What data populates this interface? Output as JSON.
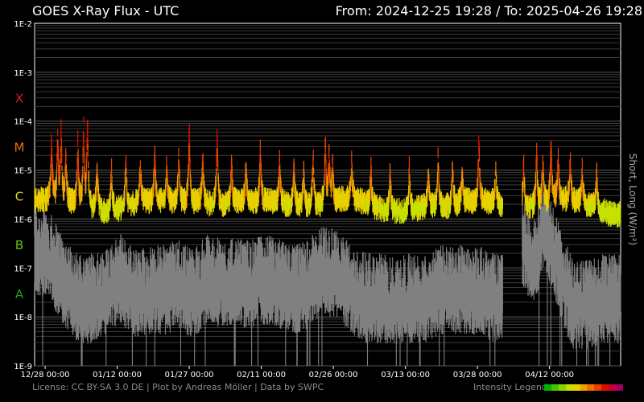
{
  "header": {
    "title": "GOES X-Ray Flux - UTC",
    "range": "From: 2024-12-25 19:28  /  To: 2025-04-26 19:28"
  },
  "footer": {
    "license": "License: CC BY-SA 3.0 DE | Plot by Andreas Möller | Data by SWPC",
    "legend_label": "Intensity Legend",
    "legend_colors": [
      "#00b000",
      "#44c400",
      "#88d400",
      "#c8e000",
      "#e8d000",
      "#f0a000",
      "#f07000",
      "#e84000",
      "#d81000",
      "#c00030",
      "#a00060"
    ]
  },
  "chart_data": {
    "type": "line",
    "ylabel": "Short, Long (W/m²)",
    "yscale": "log",
    "ylim": [
      1e-09,
      0.01
    ],
    "grid": true,
    "y_ticks": [
      "1E-9",
      "1E-8",
      "1E-7",
      "1E-6",
      "1E-5",
      "1E-4",
      "1E-3",
      "1E-2"
    ],
    "class_labels": [
      {
        "label": "X",
        "value": 0.0003,
        "color": "#d42020"
      },
      {
        "label": "M",
        "value": 3e-05,
        "color": "#f07000"
      },
      {
        "label": "C",
        "value": 3e-06,
        "color": "#d8e000"
      },
      {
        "label": "B",
        "value": 3e-07,
        "color": "#70c010"
      },
      {
        "label": "A",
        "value": 3e-08,
        "color": "#20a020"
      }
    ],
    "x_ticks": [
      "12/28 00:00",
      "01/12 00:00",
      "01/27 00:00",
      "02/11 00:00",
      "02/26 00:00",
      "03/13 00:00",
      "03/28 00:00",
      "04/12 00:00"
    ],
    "x_tick_days": [
      2.19,
      17.19,
      32.19,
      47.19,
      62.19,
      77.19,
      92.19,
      107.19
    ],
    "x_range_days": [
      0,
      122
    ],
    "series": [
      {
        "name": "Long",
        "color": "intensity",
        "baseline": [
          [
            0,
            2.5e-06
          ],
          [
            4,
            3e-06
          ],
          [
            8,
            2.5e-06
          ],
          [
            12,
            2e-06
          ],
          [
            15,
            1.5e-06
          ],
          [
            18,
            1.8e-06
          ],
          [
            22,
            2.5e-06
          ],
          [
            26,
            2.5e-06
          ],
          [
            30,
            2.5e-06
          ],
          [
            34,
            2.5e-06
          ],
          [
            38,
            2e-06
          ],
          [
            42,
            2.5e-06
          ],
          [
            46,
            2.5e-06
          ],
          [
            50,
            2.5e-06
          ],
          [
            54,
            2e-06
          ],
          [
            58,
            2e-06
          ],
          [
            62,
            2.5e-06
          ],
          [
            66,
            3e-06
          ],
          [
            70,
            2e-06
          ],
          [
            74,
            1.5e-06
          ],
          [
            78,
            1.6e-06
          ],
          [
            82,
            2e-06
          ],
          [
            86,
            2e-06
          ],
          [
            90,
            2.5e-06
          ],
          [
            94,
            2.5e-06
          ],
          [
            97.5,
            2e-06
          ],
          [
            100,
            null
          ],
          [
            101.5,
            2e-06
          ],
          [
            104,
            2e-06
          ],
          [
            108,
            3e-06
          ],
          [
            112,
            2.5e-06
          ],
          [
            116,
            2e-06
          ],
          [
            120,
            1.3e-06
          ],
          [
            122,
            1.3e-06
          ]
        ],
        "peaks": [
          [
            3.5,
            5e-05
          ],
          [
            4.8,
            6e-05
          ],
          [
            5.5,
            0.0001
          ],
          [
            6.5,
            3e-05
          ],
          [
            9,
            5e-05
          ],
          [
            10.2,
            0.00012
          ],
          [
            11,
            0.00013
          ],
          [
            13,
            1.5e-05
          ],
          [
            16,
            1.2e-05
          ],
          [
            19,
            2e-05
          ],
          [
            22,
            1.5e-05
          ],
          [
            25,
            3e-05
          ],
          [
            27.5,
            1.5e-05
          ],
          [
            30,
            2.5e-05
          ],
          [
            32.2,
            8e-05
          ],
          [
            35,
            2e-05
          ],
          [
            38,
            9e-05
          ],
          [
            41,
            1.5e-05
          ],
          [
            44,
            1.5e-05
          ],
          [
            47,
            3e-05
          ],
          [
            51,
            2e-05
          ],
          [
            54,
            1.5e-05
          ],
          [
            56,
            1.2e-05
          ],
          [
            58,
            2.5e-05
          ],
          [
            60.5,
            6e-05
          ],
          [
            61.3,
            4e-05
          ],
          [
            62,
            2e-05
          ],
          [
            66,
            1.5e-05
          ],
          [
            70,
            1.3e-05
          ],
          [
            74,
            1e-05
          ],
          [
            78,
            1.2e-05
          ],
          [
            82,
            1.2e-05
          ],
          [
            84,
            2e-05
          ],
          [
            87,
            1.5e-05
          ],
          [
            89,
            1.2e-05
          ],
          [
            92.5,
            5e-05
          ],
          [
            96,
            1.5e-05
          ],
          [
            101.8,
            1.5e-05
          ],
          [
            104.5,
            3e-05
          ],
          [
            105.8,
            2e-05
          ],
          [
            107.5,
            4e-05
          ],
          [
            109,
            2e-05
          ],
          [
            111.5,
            2e-05
          ],
          [
            114,
            1.2e-05
          ],
          [
            117,
            1e-05
          ]
        ]
      },
      {
        "name": "Short",
        "color": "#808080",
        "baseline": [
          [
            0,
            2e-07
          ],
          [
            3,
            1.5e-07
          ],
          [
            6,
            5e-08
          ],
          [
            9,
            2e-08
          ],
          [
            12,
            2e-08
          ],
          [
            15,
            3e-08
          ],
          [
            18,
            5e-08
          ],
          [
            21,
            2.5e-08
          ],
          [
            24,
            3e-08
          ],
          [
            27,
            3e-08
          ],
          [
            30,
            4e-08
          ],
          [
            33,
            2.5e-08
          ],
          [
            36,
            5e-08
          ],
          [
            39,
            4e-08
          ],
          [
            42,
            4e-08
          ],
          [
            45,
            4e-08
          ],
          [
            48,
            5e-08
          ],
          [
            51,
            4e-08
          ],
          [
            54,
            3e-08
          ],
          [
            57,
            4e-08
          ],
          [
            60,
            8e-08
          ],
          [
            63,
            6e-08
          ],
          [
            66,
            3e-08
          ],
          [
            69,
            2e-08
          ],
          [
            72,
            2e-08
          ],
          [
            75,
            1.8e-08
          ],
          [
            78,
            2e-08
          ],
          [
            81,
            2e-08
          ],
          [
            84,
            3e-08
          ],
          [
            87,
            3e-08
          ],
          [
            90,
            3e-08
          ],
          [
            93,
            3e-08
          ],
          [
            96,
            2e-08
          ],
          [
            97.5,
            2e-08
          ],
          [
            100,
            null
          ],
          [
            101.5,
            3e-07
          ],
          [
            104,
            1e-07
          ],
          [
            106,
            8e-07
          ],
          [
            108,
            2e-07
          ],
          [
            110,
            5e-08
          ],
          [
            112,
            1.5e-08
          ],
          [
            115,
            1.5e-08
          ],
          [
            118,
            2e-08
          ],
          [
            122,
            2e-08
          ]
        ]
      }
    ]
  }
}
